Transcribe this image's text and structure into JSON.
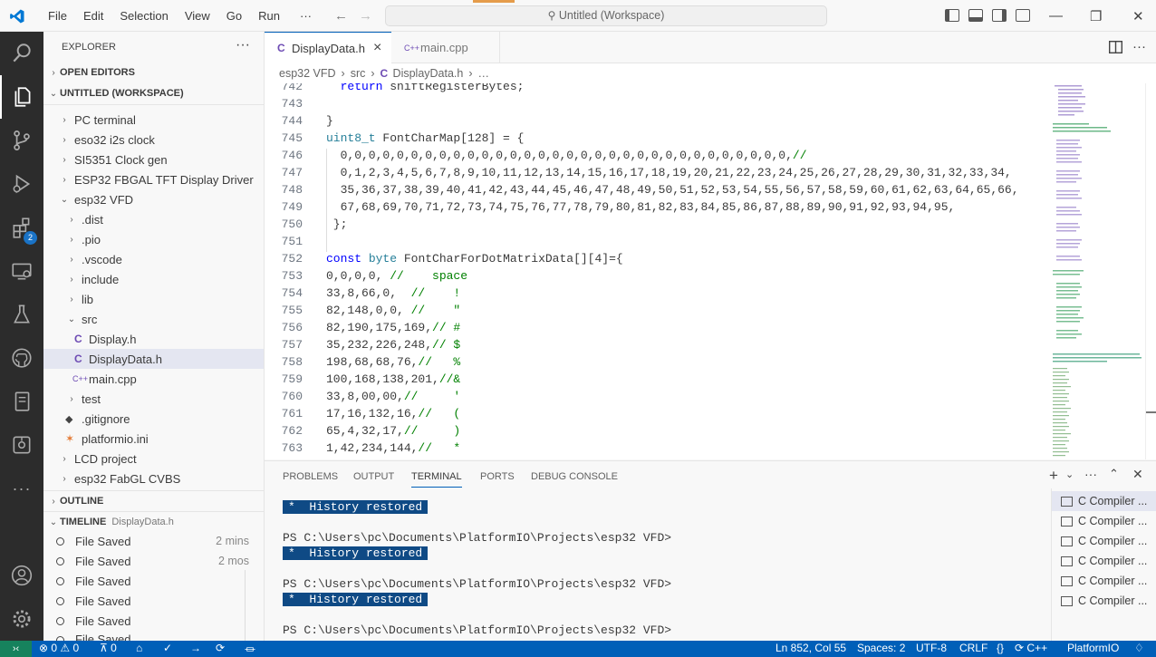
{
  "titlebar": {
    "menu": [
      "File",
      "Edit",
      "Selection",
      "View",
      "Go",
      "Run",
      "···"
    ],
    "search": "Untitled (Workspace)"
  },
  "activity_bar": {
    "extensions_badge": "2"
  },
  "explorer": {
    "title": "EXPLORER",
    "more": "···",
    "open_editors": "OPEN EDITORS",
    "workspace": "UNTITLED (WORKSPACE)",
    "tree": [
      {
        "label": "PC terminal",
        "chev": "›"
      },
      {
        "label": "eso32 i2s clock",
        "chev": "›"
      },
      {
        "label": "SI5351 Clock gen",
        "chev": "›"
      },
      {
        "label": "ESP32 FBGAL TFT Display Driver",
        "chev": "›"
      },
      {
        "label": "esp32 VFD",
        "chev": "⌄"
      },
      {
        "label": ".dist",
        "chev": "›"
      },
      {
        "label": ".pio",
        "chev": "›"
      },
      {
        "label": ".vscode",
        "chev": "›"
      },
      {
        "label": "include",
        "chev": "›"
      },
      {
        "label": "lib",
        "chev": "›"
      },
      {
        "label": "src",
        "chev": "⌄"
      },
      {
        "label": "Display.h",
        "icon": "C"
      },
      {
        "label": "DisplayData.h",
        "icon": "C"
      },
      {
        "label": "main.cpp",
        "icon": "C++"
      },
      {
        "label": "test",
        "chev": "›"
      },
      {
        "label": ".gitignore",
        "icon": "◆"
      },
      {
        "label": "platformio.ini",
        "icon": "✶"
      },
      {
        "label": "LCD project",
        "chev": "›"
      },
      {
        "label": "esp32 FabGL CVBS",
        "chev": "›"
      }
    ],
    "outline": "OUTLINE",
    "timeline": "TIMELINE",
    "timeline_file": "DisplayData.h",
    "timeline_items": [
      {
        "label": "File Saved",
        "time": "2 mins"
      },
      {
        "label": "File Saved",
        "time": "2 mos"
      },
      {
        "label": "File Saved",
        "time": ""
      },
      {
        "label": "File Saved",
        "time": ""
      },
      {
        "label": "File Saved",
        "time": ""
      },
      {
        "label": "File Saved",
        "time": ""
      }
    ]
  },
  "tabs": [
    {
      "label": "DisplayData.h",
      "icon": "C",
      "close": "×"
    },
    {
      "label": "main.cpp",
      "icon": "C++"
    }
  ],
  "breadcrumb": [
    "esp32 VFD",
    "src",
    "DisplayData.h",
    "…"
  ],
  "code": [
    {
      "n": "742",
      "t": "  return shiftRegisterBytes;"
    },
    {
      "n": "743",
      "t": ""
    },
    {
      "n": "744",
      "t": "}"
    },
    {
      "n": "745",
      "t": "uint8_t FontCharMap[128] = {"
    },
    {
      "n": "746",
      "t": "  0,0,0,0,0,0,0,0,0,0,0,0,0,0,0,0,0,0,0,0,0,0,0,0,0,0,0,0,0,0,0,0,//"
    },
    {
      "n": "747",
      "t": "  0,1,2,3,4,5,6,7,8,9,10,11,12,13,14,15,16,17,18,19,20,21,22,23,24,25,26,27,28,29,30,31,32,33,34,"
    },
    {
      "n": "748",
      "t": "  35,36,37,38,39,40,41,42,43,44,45,46,47,48,49,50,51,52,53,54,55,56,57,58,59,60,61,62,63,64,65,66,"
    },
    {
      "n": "749",
      "t": "  67,68,69,70,71,72,73,74,75,76,77,78,79,80,81,82,83,84,85,86,87,88,89,90,91,92,93,94,95,"
    },
    {
      "n": "750",
      "t": " };"
    },
    {
      "n": "751",
      "t": ""
    },
    {
      "n": "752",
      "t": "const byte FontCharForDotMatrixData[][4]={"
    },
    {
      "n": "753",
      "t": "0,0,0,0, //    space"
    },
    {
      "n": "754",
      "t": "33,8,66,0,  //    !"
    },
    {
      "n": "755",
      "t": "82,148,0,0, //    \""
    },
    {
      "n": "756",
      "t": "82,190,175,169,// #"
    },
    {
      "n": "757",
      "t": "35,232,226,248,// $"
    },
    {
      "n": "758",
      "t": "198,68,68,76,//   %"
    },
    {
      "n": "759",
      "t": "100,168,138,201,//&"
    },
    {
      "n": "760",
      "t": "33,8,00,00,//     '"
    },
    {
      "n": "761",
      "t": "17,16,132,16,//   ("
    },
    {
      "n": "762",
      "t": "65,4,32,17,//     )"
    },
    {
      "n": "763",
      "t": "1,42,234,144,//   *"
    }
  ],
  "panel": {
    "tabs": [
      "PROBLEMS",
      "OUTPUT",
      "TERMINAL",
      "PORTS",
      "DEBUG CONSOLE"
    ],
    "history": "*  History restored",
    "prompt": "PS C:\\Users\\pc\\Documents\\PlatformIO\\Projects\\esp32 VFD>",
    "terminals": [
      "C Compiler ...",
      "C Compiler ...",
      "C Compiler ...",
      "C Compiler ...",
      "C Compiler ...",
      "C Compiler ..."
    ]
  },
  "status": {
    "errors": "⊗ 0 ⚠ 0",
    "ports": "0",
    "position": "Ln 852, Col 55",
    "spaces": "Spaces: 2",
    "encoding": "UTF-8",
    "eol": "CRLF",
    "language": "C++",
    "platform": "PlatformIO"
  }
}
